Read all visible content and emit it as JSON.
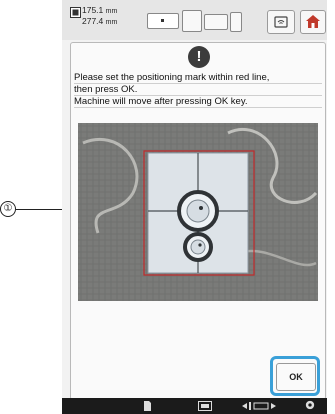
{
  "topbar": {
    "size_width_value": "175.1",
    "size_height_value": "277.4",
    "size_unit": "mm",
    "icons": [
      "embroidery-size-icon",
      "wifi-icon",
      "home-icon"
    ]
  },
  "dialog": {
    "warning_symbol": "!",
    "lines": [
      "Please set the positioning mark within red line,",
      "then press OK.",
      "Machine will move after pressing OK key."
    ],
    "ok_label": "OK"
  },
  "callout": {
    "label": "①"
  },
  "colors": {
    "highlight": "#3aa0d8",
    "marker": "#e4eaf0",
    "red_line": "#c22b2b"
  }
}
